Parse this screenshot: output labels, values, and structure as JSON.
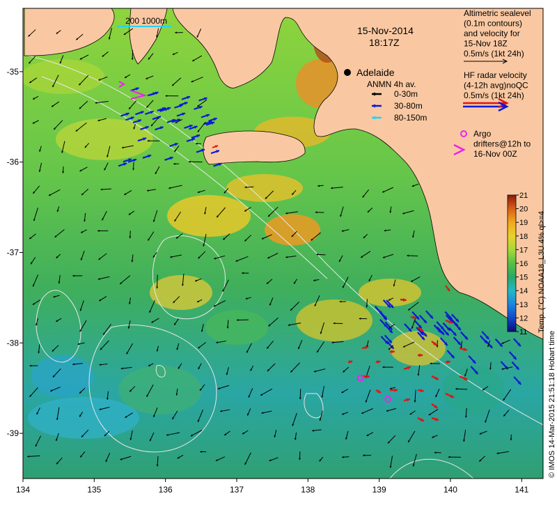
{
  "header": {
    "date": "15-Nov-2014",
    "time": "18:17Z"
  },
  "scale_bar": {
    "label": "200  1000m"
  },
  "place_label": "Adelaide",
  "anmn_legend": {
    "title": "ANMN 4h av.",
    "items": [
      {
        "label": "0-30m",
        "color": "#000000"
      },
      {
        "label": "30-80m",
        "color": "#0a1ad6"
      },
      {
        "label": "80-150m",
        "color": "#28d2ee"
      }
    ]
  },
  "altimetry_note": {
    "lines": [
      "Altimetric sealevel",
      "(0.1m contours)",
      "and velocity for",
      "15-Nov 18Z",
      "0.5m/s (1kt 24h)"
    ]
  },
  "hf_radar_note": {
    "lines": [
      "HF radar velocity",
      "(4-12h avg)noQC",
      "0.5m/s (1kt 24h)"
    ]
  },
  "argo_note": {
    "lines": [
      "Argo",
      "drifters@12h to",
      "16-Nov 00Z"
    ]
  },
  "colorbar": {
    "ticks": [
      "21",
      "20",
      "19",
      "18",
      "17",
      "16",
      "15",
      "14",
      "13",
      "12",
      "11"
    ],
    "label": "Temp. (°C) NOAA18_L3U 4% ql>=4",
    "min": 11,
    "max": 21
  },
  "credit": "© IMOS 14-Mar-2015 21:51:18 Hobart time",
  "axes": {
    "x_ticks": [
      "134",
      "135",
      "136",
      "137",
      "138",
      "139",
      "140",
      "141"
    ],
    "y_ticks": [
      "-35",
      "-36",
      "-37",
      "-38",
      "-39"
    ],
    "lon_range": [
      134,
      141.3
    ],
    "lat_range": [
      -39.5,
      -34.3
    ]
  },
  "colors": {
    "land": "#f9c8a2",
    "hf_radar": "#e01515",
    "argo": "#ee22ee",
    "contour": "#e8e8e8"
  }
}
